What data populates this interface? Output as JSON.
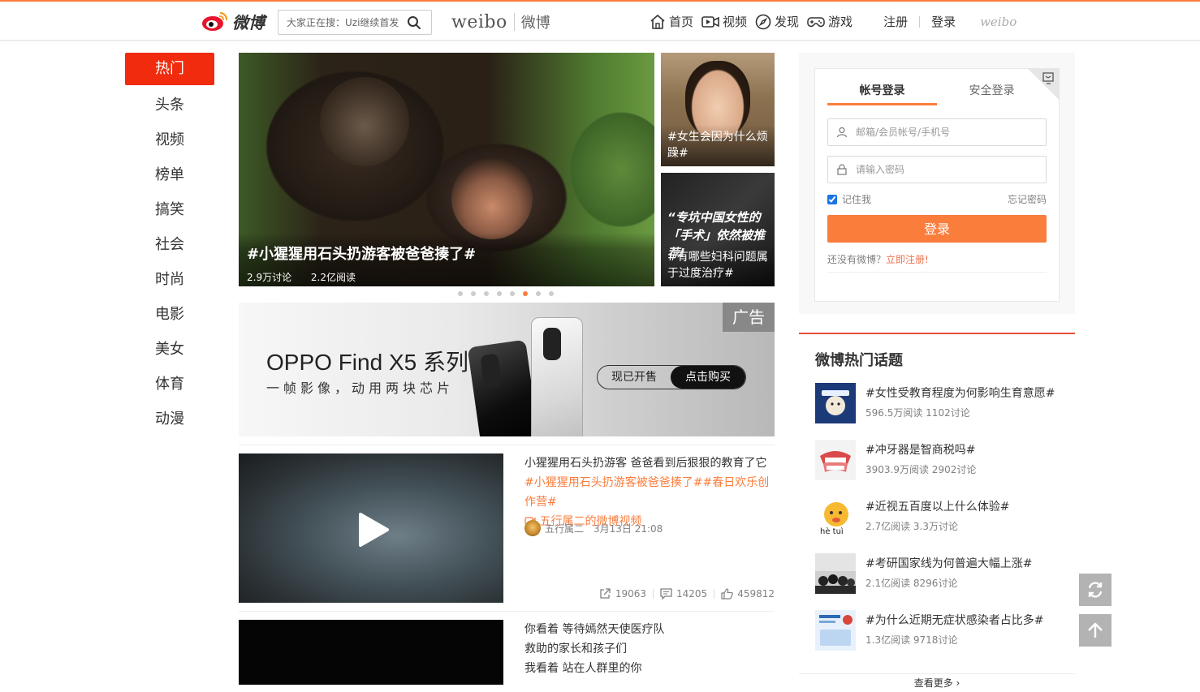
{
  "header": {
    "logo_text": "微博",
    "search_placeholder": "大家正在搜：Uzi继续首发",
    "brand_en": "weibo",
    "brand_zh": "微博",
    "nav": [
      {
        "label": "首页",
        "icon": "home-icon"
      },
      {
        "label": "视频",
        "icon": "video-icon"
      },
      {
        "label": "发现",
        "icon": "compass-icon"
      },
      {
        "label": "游戏",
        "icon": "gamepad-icon"
      }
    ],
    "register": "注册",
    "login": "登录",
    "weibo_mark": "weibo"
  },
  "sidebar": {
    "items": [
      "热门",
      "头条",
      "视频",
      "榜单",
      "搞笑",
      "社会",
      "时尚",
      "电影",
      "美女",
      "体育",
      "动漫"
    ],
    "active_index": 0
  },
  "carousel": {
    "main": {
      "title": "#小猩猩用石头扔游客被爸爸揍了#",
      "discussions": "2.9万讨论",
      "reads": "2.2亿阅读"
    },
    "side": [
      {
        "title": "#女生会因为什么烦躁#"
      },
      {
        "quote_line1": "“专坑中国女性的",
        "quote_line2": "「手术」依然被推荐!",
        "title": "#有哪些妇科问题属于过度治疗#"
      }
    ],
    "dots": 8,
    "active_dot": 5
  },
  "ad": {
    "title": "OPPO Find X5 系列",
    "subtitle": "一帧影像，动用两块芯片",
    "btn_left": "现已开售",
    "btn_right": "点击购买",
    "badge": "广告"
  },
  "posts": [
    {
      "text": "小猩猩用石头扔游客 爸爸看到后狠狠的教育了它",
      "tags": "#小猩猩用石头扔游客被爸爸揍了##春日欢乐创作营#",
      "video_link": "五行属二的微博视频",
      "author": "五行属二",
      "time": "3月13日 21:08",
      "reposts": "19063",
      "comments": "14205",
      "likes": "459812"
    },
    {
      "line1": "你看着 等待嫣然天使医疗队",
      "line2": "救助的家长和孩子们",
      "line3": "我看着 站在人群里的你"
    }
  ],
  "login": {
    "tab_account": "帐号登录",
    "tab_secure": "安全登录",
    "user_placeholder": "邮箱/会员帐号/手机号",
    "pass_placeholder": "请输入密码",
    "remember": "记住我",
    "forgot": "忘记密码",
    "submit": "登录",
    "no_account": "还没有微博？",
    "register_now": "立即注册!"
  },
  "hot_topics": {
    "title": "微博热门话题",
    "items": [
      {
        "name": "#女性受教育程度为何影响生育意愿#",
        "meta": "596.5万阅读 1102讨论"
      },
      {
        "name": "#冲牙器是智商税吗#",
        "meta": "3903.9万阅读 2902讨论"
      },
      {
        "name": "#近视五百度以上什么体验#",
        "meta": "2.7亿阅读 3.3万讨论"
      },
      {
        "name": "#考研国家线为何普遍大幅上涨#",
        "meta": "2.1亿阅读 8296讨论"
      },
      {
        "name": "#为什么近期无症状感染者占比多#",
        "meta": "1.3亿阅读 9718讨论"
      }
    ],
    "more": "查看更多 ›"
  },
  "colors": {
    "accent": "#fa7d3c",
    "active_red": "#f12b0e",
    "hot_border": "#e7503e"
  }
}
